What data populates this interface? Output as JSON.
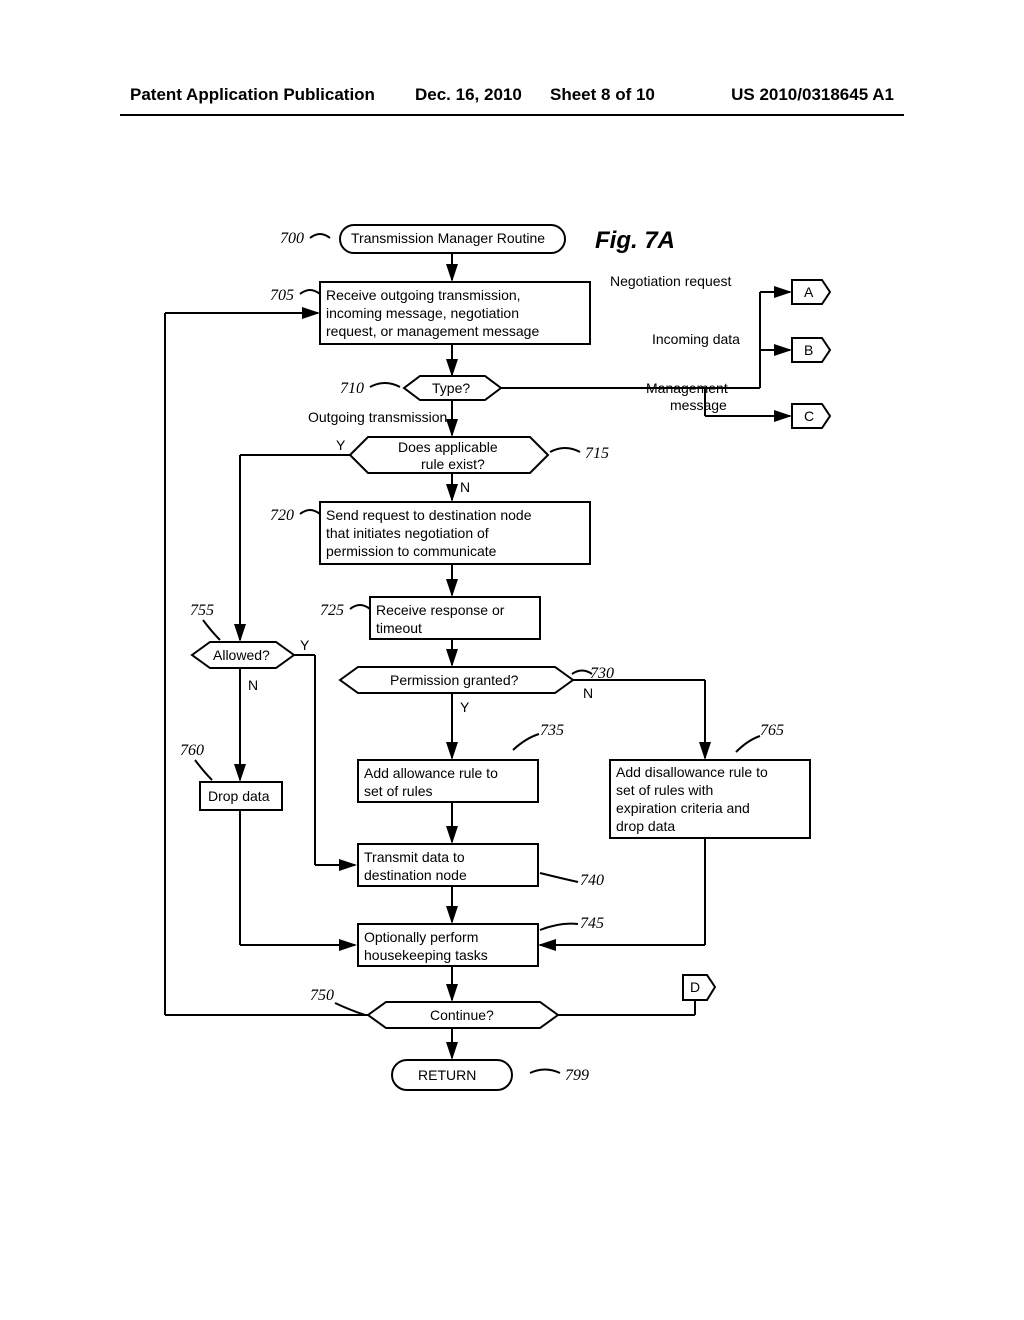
{
  "header": {
    "pub": "Patent Application Publication",
    "date": "Dec. 16, 2010",
    "sheet": "Sheet 8 of 10",
    "pubno": "US 2010/0318645 A1"
  },
  "figure_title": "Fig. 7A",
  "nodes": {
    "n700": {
      "label": "700",
      "text": "Transmission Manager Routine"
    },
    "n705": {
      "label": "705",
      "text1": "Receive outgoing transmission,",
      "text2": "incoming message, negotiation",
      "text3": "request, or management message"
    },
    "n710": {
      "label": "710",
      "text": "Type?"
    },
    "n715": {
      "label": "715",
      "text1": "Does applicable",
      "text2": "rule exist?"
    },
    "n720": {
      "label": "720",
      "text1": "Send request to destination node",
      "text2": "that initiates negotiation of",
      "text3": "permission to communicate"
    },
    "n725": {
      "label": "725",
      "text1": "Receive response or",
      "text2": "timeout"
    },
    "n730": {
      "label": "730",
      "text": "Permission granted?"
    },
    "n735": {
      "label": "735",
      "text1": "Add allowance rule to",
      "text2": "set of rules"
    },
    "n740": {
      "label": "740",
      "text1": "Transmit data to",
      "text2": "destination node"
    },
    "n745": {
      "label": "745",
      "text1": "Optionally perform",
      "text2": "housekeeping tasks"
    },
    "n750": {
      "label": "750",
      "text": "Continue?"
    },
    "n755": {
      "label": "755",
      "text": "Allowed?"
    },
    "n760": {
      "label": "760",
      "text": "Drop data"
    },
    "n765": {
      "label": "765",
      "text1": "Add disallowance rule to",
      "text2": "set of rules with",
      "text3": "expiration criteria and",
      "text4": "drop data"
    },
    "n799": {
      "label": "799",
      "text": "RETURN"
    }
  },
  "branches": {
    "outgoing": "Outgoing transmission",
    "negotiation": "Negotiation request",
    "incoming": "Incoming data",
    "management": "Management message",
    "yes": "Y",
    "no": "N"
  },
  "connectors": {
    "a": "A",
    "b": "B",
    "c": "C",
    "d": "D"
  }
}
